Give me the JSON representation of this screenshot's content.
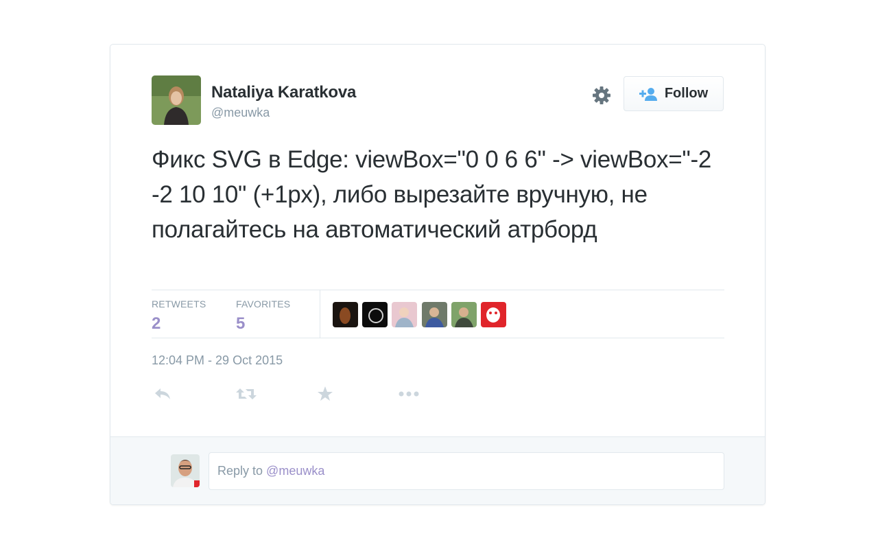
{
  "tweet": {
    "author": {
      "full_name": "Nataliya Karatkova",
      "screen_name": "@meuwka",
      "avatar_icon": "profile-photo"
    },
    "follow_button_label": "Follow",
    "text": "Фикс SVG в Edge: viewBox=\"0 0 6 6\" -> viewBox=\"-2 -2 10 10\" (+1px), либо вырезайте вручную, не полагайтесь на автоматический атрборд",
    "stats": {
      "retweets_label": "RETWEETS",
      "retweets_count": "2",
      "favorites_label": "FAVORITES",
      "favorites_count": "5"
    },
    "favorited_by_count": 6,
    "timestamp": "12:04 PM - 29 Oct 2015",
    "actions": [
      "reply-icon",
      "retweet-icon",
      "favorite-icon",
      "more-icon"
    ]
  },
  "reply_box": {
    "placeholder_prefix": "Reply to",
    "placeholder_mention": "@meuwka"
  },
  "colors": {
    "text": "#292f33",
    "muted": "#8899a6",
    "stat_value": "#9a8fc9",
    "border": "#e1e8ed",
    "follow_icon": "#55acee",
    "reply_bg": "#f5f8fa"
  }
}
